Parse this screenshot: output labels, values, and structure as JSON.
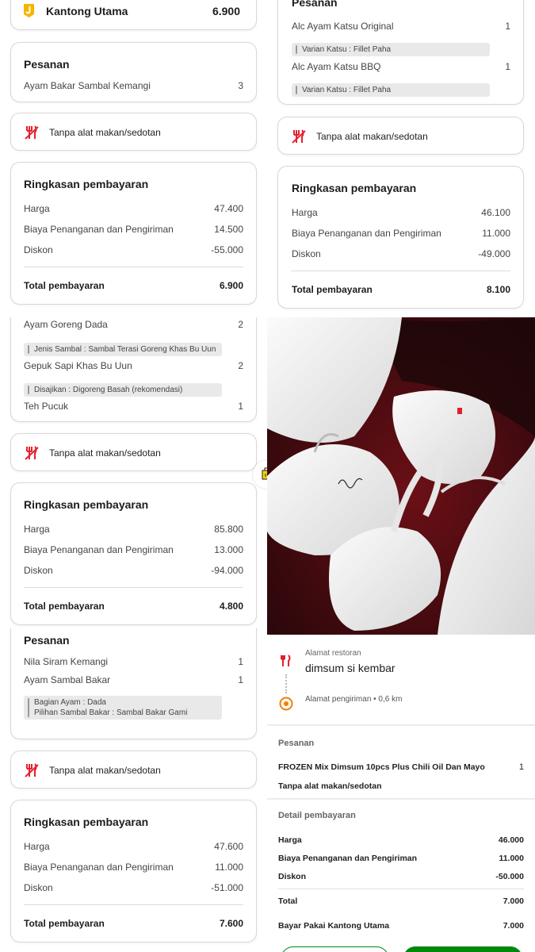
{
  "top_left": {
    "wallet": {
      "label": "Kantong Utama",
      "amount": "6.900"
    },
    "order": {
      "title": "Pesanan",
      "items": [
        {
          "name": "Ayam Bakar Sambal Kemangi",
          "qty": "3"
        }
      ]
    },
    "no_cutlery": "Tanpa alat makan/sedotan",
    "summary": {
      "title": "Ringkasan pembayaran",
      "rows": [
        {
          "label": "Harga",
          "value": "47.400"
        },
        {
          "label": "Biaya Penanganan dan Pengiriman",
          "value": "14.500"
        },
        {
          "label": "Diskon",
          "value": "-55.000"
        }
      ],
      "total_label": "Total pembayaran",
      "total_value": "6.900"
    }
  },
  "top_right": {
    "order": {
      "title": "Pesanan",
      "items": [
        {
          "name": "Alc Ayam Katsu Original",
          "qty": "1",
          "note": "Varian Katsu : Fillet Paha"
        },
        {
          "name": "Alc Ayam Katsu BBQ",
          "qty": "1",
          "note": "Varian Katsu : Fillet Paha"
        }
      ]
    },
    "no_cutlery": "Tanpa alat makan/sedotan",
    "summary": {
      "title": "Ringkasan pembayaran",
      "rows": [
        {
          "label": "Harga",
          "value": "46.100"
        },
        {
          "label": "Biaya Penanganan dan Pengiriman",
          "value": "11.000"
        },
        {
          "label": "Diskon",
          "value": "-49.000"
        }
      ],
      "total_label": "Total pembayaran",
      "total_value": "8.100"
    }
  },
  "mid_left": {
    "order": {
      "items": [
        {
          "name": "Ayam Goreng Dada",
          "qty": "2",
          "note": "Jenis Sambal : Sambal Terasi Goreng Khas Bu Uun"
        },
        {
          "name": "Gepuk Sapi Khas Bu Uun",
          "qty": "2",
          "note": "Disajikan : Digoreng Basah (rekomendasi)"
        },
        {
          "name": "Teh Pucuk",
          "qty": "1"
        }
      ]
    },
    "no_cutlery": "Tanpa alat makan/sedotan",
    "summary": {
      "title": "Ringkasan pembayaran",
      "rows": [
        {
          "label": "Harga",
          "value": "85.800"
        },
        {
          "label": "Biaya Penanganan dan Pengiriman",
          "value": "13.000"
        },
        {
          "label": "Diskon",
          "value": "-94.000"
        }
      ],
      "total_label": "Total pembayaran",
      "total_value": "4.800"
    }
  },
  "bottom_left": {
    "order": {
      "title": "Pesanan",
      "items": [
        {
          "name": "Nila Siram Kemangi",
          "qty": "1"
        },
        {
          "name": "Ayam Sambal Bakar",
          "qty": "1"
        }
      ],
      "notes": [
        "Bagian Ayam : Dada",
        "Pilihan Sambal Bakar : Sambal Bakar Gami"
      ]
    },
    "no_cutlery": "Tanpa alat makan/sedotan",
    "summary": {
      "title": "Ringkasan pembayaran",
      "rows": [
        {
          "label": "Harga",
          "value": "47.600"
        },
        {
          "label": "Biaya Penanganan dan Pengiriman",
          "value": "11.000"
        },
        {
          "label": "Diskon",
          "value": "-51.000"
        }
      ],
      "total_label": "Total pembayaran",
      "total_value": "7.600"
    }
  },
  "bottom_right": {
    "restaurant_caption": "Alamat restoran",
    "restaurant_name": "dimsum si kembar",
    "delivery": "Alamat pengiriman • 0,6 km",
    "order_title": "Pesanan",
    "order_item": {
      "name": "FROZEN Mix Dimsum 10pcs Plus Chili Oil Dan Mayo",
      "qty": "1"
    },
    "no_cutlery": "Tanpa alat makan/sedotan",
    "detail_title": "Detail pembayaran",
    "rows": [
      {
        "label": "Harga",
        "value": "46.000"
      },
      {
        "label": "Biaya Penanganan dan Pengiriman",
        "value": "11.000"
      },
      {
        "label": "Diskon",
        "value": "-50.000"
      }
    ],
    "total": {
      "label": "Total",
      "value": "7.000"
    },
    "paid_with": {
      "label": "Bayar Pakai Kantong Utama",
      "value": "7.000"
    }
  },
  "colors": {
    "accent_red": "#e4202d",
    "brand_green": "#00880d",
    "card_border": "#d8d8d8",
    "wallet_yellow": "#f7b500"
  }
}
